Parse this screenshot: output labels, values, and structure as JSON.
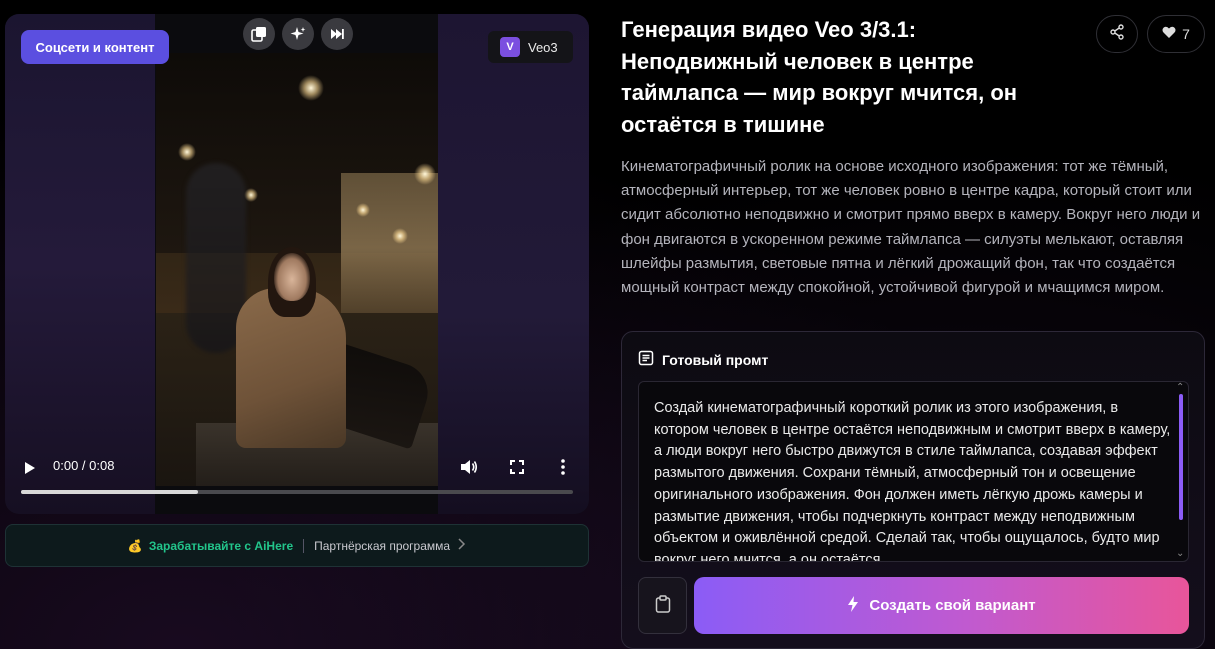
{
  "video": {
    "social_label": "Соцсети и контент",
    "model_logo": "V",
    "model_name": "Veo3",
    "time": "0:00 / 0:08",
    "progress": 0.32,
    "top_icons": [
      "gallery-icon",
      "sparkle-icon",
      "skip-icon"
    ]
  },
  "partner": {
    "emoji": "💰",
    "main_label": "Зарабатывайте с AiHere",
    "sub_label": "Партнёрская программа"
  },
  "header": {
    "title": "Генерация видео Veo 3/3.1: Неподвижный человек в центре таймлапса — мир вокруг мчится, он остаётся в тишине",
    "likes": "7"
  },
  "description": "Кинематографичный ролик на основе исходного изображения: тот же тёмный, атмосферный интерьер, тот же человек ровно в центре кадра, который стоит или сидит абсолютно неподвижно и смотрит прямо вверх в камеру. Вокруг него люди и фон двигаются в ускоренном режиме таймлапса — силуэты мелькают, оставляя шлейфы размытия, световые пятна и лёгкий дрожащий фон, так что создаётся мощный контраст между спокойной, устойчивой фигурой и мчащимся миром.",
  "prompt": {
    "heading": "Готовый промт",
    "text": "Создай кинематографичный короткий ролик из этого изображения, в котором человек в центре остаётся неподвижным и смотрит вверх в камеру, а люди вокруг него быстро движутся в стиле таймлапса, создавая эффект размытого движения. Сохрани тёмный, атмосферный тон и освещение оригинального изображения. Фон должен иметь лёгкую дрожь камеры и размытие движения, чтобы подчеркнуть контраст между неподвижным объектом и оживлённой средой. Сделай так, чтобы ощущалось, будто мир вокруг него мчится, а он остаётся",
    "create_label": "Создать свой вариант"
  },
  "colors": {
    "accent": "#5b4fe0",
    "partner_green": "#22c58b",
    "gradient_start": "#8b5cf6",
    "gradient_end": "#e8559a"
  }
}
